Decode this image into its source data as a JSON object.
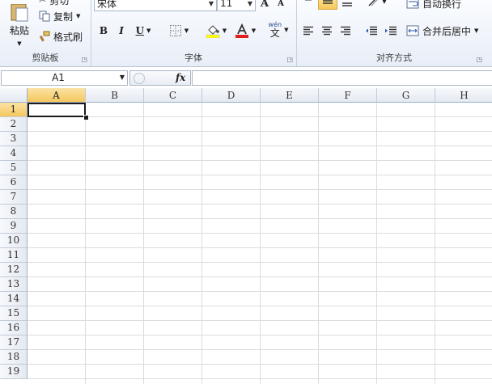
{
  "clipboard": {
    "paste_label": "粘贴",
    "cut_label": "剪切",
    "copy_label": "复制",
    "format_painter_label": "格式刷",
    "group_title": "剪贴板"
  },
  "font": {
    "font_name": "宋体",
    "font_size": "11",
    "grow_label": "A",
    "shrink_label": "A",
    "bold_label": "B",
    "italic_label": "I",
    "underline_label": "U",
    "phonetic_label": "wén",
    "group_title": "字体",
    "fill_color": "#ffff00",
    "font_color": "#e02020"
  },
  "alignment": {
    "wrap_text_label": "自动换行",
    "merge_center_label": "合并后居中",
    "group_title": "对齐方式"
  },
  "formula_bar": {
    "name_box": "A1",
    "fx_label": "fx",
    "formula": ""
  },
  "grid": {
    "columns": [
      "A",
      "B",
      "C",
      "D",
      "E",
      "F",
      "G",
      "H"
    ],
    "rows": [
      "1",
      "2",
      "3",
      "4",
      "5",
      "6",
      "7",
      "8",
      "9",
      "10",
      "11",
      "12",
      "13",
      "14",
      "15",
      "16",
      "17",
      "18",
      "19"
    ],
    "active_cell": "A1"
  },
  "colors": {
    "ribbon_bg": "#e8eef7",
    "selected_header": "#f4c75e",
    "gridline": "#dadcdd"
  }
}
